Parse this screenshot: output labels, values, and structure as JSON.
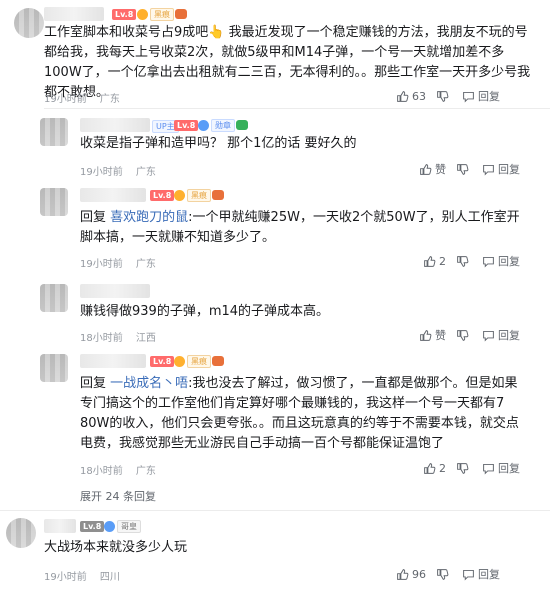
{
  "comments": [
    {
      "level": "Lv.8",
      "medal": "黑痕",
      "text": "工作室脚本和收菜号占9成吧👆 我最近发现了一个稳定赚钱的方法，我朋友不玩的号都给我，我每天上号收菜2次，就做5级甲和M14子弹，一个号一天就增加差不多100W了，一个亿拿出去出租就有二三百，无本得利的。。那些工作室一天开多少号我都不敢想。",
      "time": "19小时前",
      "location": "广东",
      "likes": "63",
      "reply_label": "回复"
    },
    {
      "tag": "UP主",
      "level": "Lv.8",
      "medal": "勋章",
      "text": "收菜是指子弹和造甲吗？ 那个1亿的话 要好久的",
      "time": "19小时前",
      "location": "广东",
      "like_label": "赞",
      "reply_label": "回复"
    },
    {
      "level": "Lv.8",
      "medal": "黑痕",
      "reply_prefix": "回复",
      "reply_target": "喜欢跑刀的鼠",
      "text": ":一个甲就纯赚25W，一天收2个就50W了，别人工作室开脚本搞，一天就赚不知道多少了。",
      "time": "19小时前",
      "location": "广东",
      "likes": "2",
      "reply_label": "回复"
    },
    {
      "text": "赚钱得做939的子弹，m14的子弹成本高。",
      "time": "18小时前",
      "location": "江西",
      "like_label": "赞",
      "reply_label": "回复"
    },
    {
      "level": "Lv.8",
      "medal": "黑痕",
      "reply_prefix": "回复",
      "reply_target": "一战成名丶唔",
      "text": ":我也没去了解过，做习惯了，一直都是做那个。但是如果专门搞这个的工作室他们肯定算好哪个最赚钱的，我这样一个号一天都有7 80W的收入，他们只会更夸张。。而且这玩意真的约等于不需要本钱，就交点电费，我感觉那些无业游民自己手动搞一百个号都能保证温饱了",
      "time": "18小时前",
      "location": "广东",
      "likes": "2",
      "reply_label": "回复"
    },
    {
      "level": "Lv.8",
      "medal": "哥皇",
      "text": "大战场本来就没多少人玩",
      "time": "19小时前",
      "location": "四川",
      "likes": "96",
      "reply_label": "回复"
    }
  ],
  "expand": {
    "prefix": "展开",
    "count": "24",
    "suffix": "条回复"
  }
}
